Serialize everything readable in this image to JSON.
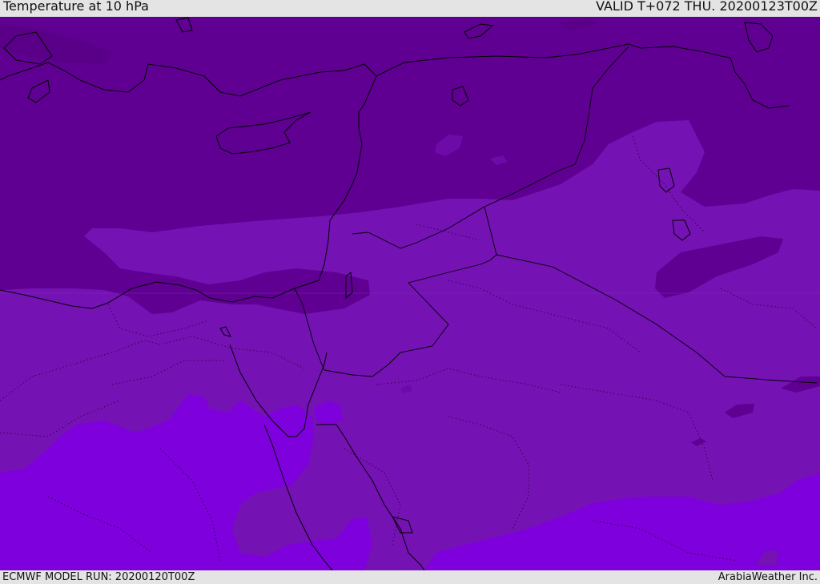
{
  "header": {
    "title": "Temperature at 10 hPa",
    "valid_time": "VALID T+072 THU. 20200123T00Z"
  },
  "footer": {
    "model_run": "ECMWF MODEL RUN: 20200120T00Z",
    "credit": "ArabiaWeather Inc."
  },
  "map": {
    "variable": "Temperature",
    "level": "10 hPa",
    "region": "Eastern Mediterranean / Middle East",
    "colors": {
      "coldest": "#5f0092",
      "cold": "#6e0aa8",
      "mid": "#7512b4",
      "warm": "#7e00dc",
      "coastline": "#000000"
    }
  }
}
